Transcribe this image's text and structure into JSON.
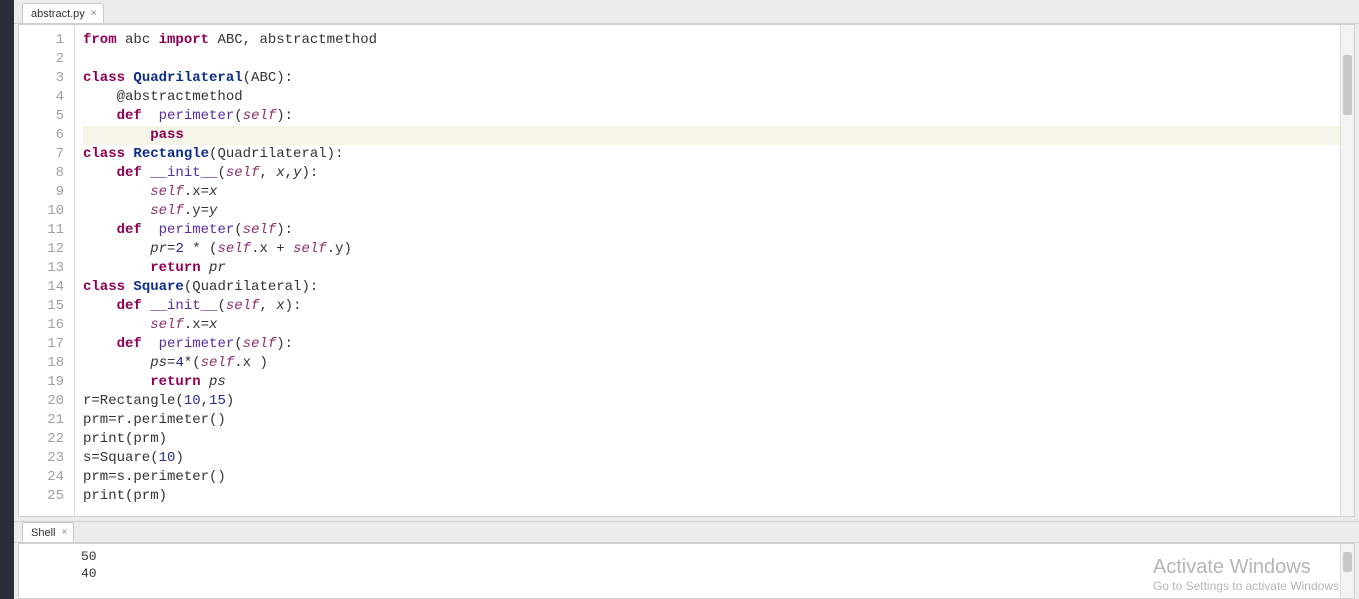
{
  "editorTab": {
    "label": "abstract.py"
  },
  "shellTab": {
    "label": "Shell"
  },
  "code": {
    "highlightLine": 6,
    "lines": [
      [
        [
          "kw",
          "from"
        ],
        [
          "pun",
          " abc "
        ],
        [
          "kw",
          "import"
        ],
        [
          "pun",
          " ABC, abstractmethod"
        ]
      ],
      [],
      [
        [
          "kw",
          "class "
        ],
        [
          "cls",
          "Quadrilateral"
        ],
        [
          "pun",
          "(ABC):"
        ]
      ],
      [
        [
          "pun",
          "    @abstractmethod"
        ]
      ],
      [
        [
          "pun",
          "    "
        ],
        [
          "kw",
          "def"
        ],
        [
          "pun",
          "  "
        ],
        [
          "fn",
          "perimeter"
        ],
        [
          "pun",
          "("
        ],
        [
          "slf",
          "self"
        ],
        [
          "pun",
          "):"
        ]
      ],
      [
        [
          "pun",
          "        "
        ],
        [
          "kw",
          "pass"
        ]
      ],
      [
        [
          "kw",
          "class "
        ],
        [
          "cls",
          "Rectangle"
        ],
        [
          "pun",
          "(Quadrilateral):"
        ]
      ],
      [
        [
          "pun",
          "    "
        ],
        [
          "kw",
          "def "
        ],
        [
          "fn",
          "__init__"
        ],
        [
          "pun",
          "("
        ],
        [
          "slf",
          "self"
        ],
        [
          "pun",
          ", "
        ],
        [
          "var",
          "x"
        ],
        [
          "pun",
          ","
        ],
        [
          "var",
          "y"
        ],
        [
          "pun",
          "):"
        ]
      ],
      [
        [
          "pun",
          "        "
        ],
        [
          "slf",
          "self"
        ],
        [
          "pun",
          ".x="
        ],
        [
          "var",
          "x"
        ]
      ],
      [
        [
          "pun",
          "        "
        ],
        [
          "slf",
          "self"
        ],
        [
          "pun",
          ".y="
        ],
        [
          "var",
          "y"
        ]
      ],
      [
        [
          "pun",
          "    "
        ],
        [
          "kw",
          "def"
        ],
        [
          "pun",
          "  "
        ],
        [
          "fn",
          "perimeter"
        ],
        [
          "pun",
          "("
        ],
        [
          "slf",
          "self"
        ],
        [
          "pun",
          "):"
        ]
      ],
      [
        [
          "pun",
          "        "
        ],
        [
          "var",
          "pr"
        ],
        [
          "pun",
          "="
        ],
        [
          "num",
          "2"
        ],
        [
          "pun",
          " * ("
        ],
        [
          "slf",
          "self"
        ],
        [
          "pun",
          ".x + "
        ],
        [
          "slf",
          "self"
        ],
        [
          "pun",
          ".y)"
        ]
      ],
      [
        [
          "pun",
          "        "
        ],
        [
          "kw",
          "return "
        ],
        [
          "var",
          "pr"
        ]
      ],
      [
        [
          "kw",
          "class "
        ],
        [
          "cls",
          "Square"
        ],
        [
          "pun",
          "(Quadrilateral):"
        ]
      ],
      [
        [
          "pun",
          "    "
        ],
        [
          "kw",
          "def "
        ],
        [
          "fn",
          "__init__"
        ],
        [
          "pun",
          "("
        ],
        [
          "slf",
          "self"
        ],
        [
          "pun",
          ", "
        ],
        [
          "var",
          "x"
        ],
        [
          "pun",
          "):"
        ]
      ],
      [
        [
          "pun",
          "        "
        ],
        [
          "slf",
          "self"
        ],
        [
          "pun",
          ".x="
        ],
        [
          "var",
          "x"
        ]
      ],
      [
        [
          "pun",
          "    "
        ],
        [
          "kw",
          "def"
        ],
        [
          "pun",
          "  "
        ],
        [
          "fn",
          "perimeter"
        ],
        [
          "pun",
          "("
        ],
        [
          "slf",
          "self"
        ],
        [
          "pun",
          "):"
        ]
      ],
      [
        [
          "pun",
          "        "
        ],
        [
          "var",
          "ps"
        ],
        [
          "pun",
          "="
        ],
        [
          "num",
          "4"
        ],
        [
          "pun",
          "*("
        ],
        [
          "slf",
          "self"
        ],
        [
          "pun",
          ".x )"
        ]
      ],
      [
        [
          "pun",
          "        "
        ],
        [
          "kw",
          "return "
        ],
        [
          "var",
          "ps"
        ]
      ],
      [
        [
          "pun",
          "r=Rectangle("
        ],
        [
          "num",
          "10"
        ],
        [
          "pun",
          ","
        ],
        [
          "num",
          "15"
        ],
        [
          "pun",
          ")"
        ]
      ],
      [
        [
          "pun",
          "prm=r.perimeter()"
        ]
      ],
      [
        [
          "pun",
          "print(prm)"
        ]
      ],
      [
        [
          "pun",
          "s=Square("
        ],
        [
          "num",
          "10"
        ],
        [
          "pun",
          ")"
        ]
      ],
      [
        [
          "pun",
          "prm=s.perimeter()"
        ]
      ],
      [
        [
          "pun",
          "print(prm)"
        ]
      ]
    ]
  },
  "shell": {
    "lines": [
      "50",
      "40"
    ]
  },
  "watermark": {
    "line1": "Activate Windows",
    "line2": "Go to Settings to activate Windows"
  }
}
